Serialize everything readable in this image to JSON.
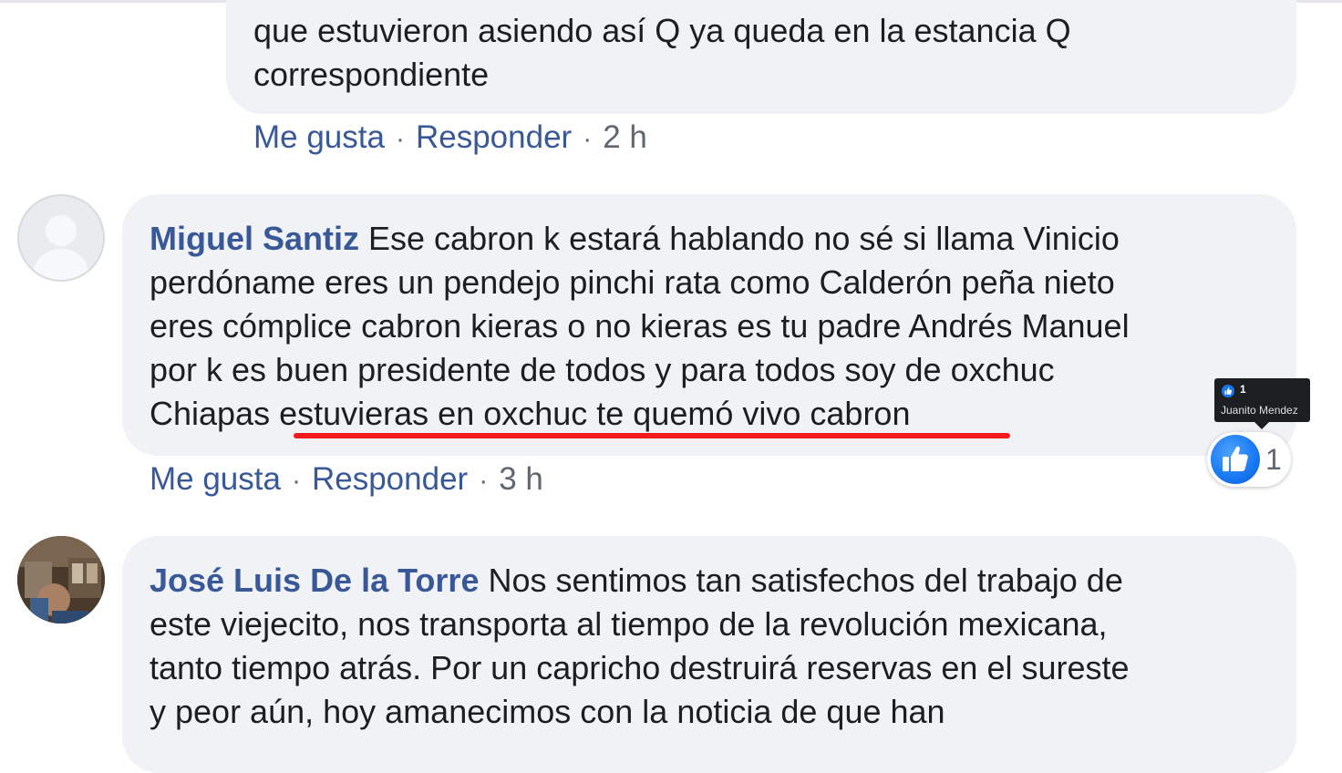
{
  "comments": [
    {
      "author": "",
      "text_lines": [
        "que estuvieron asiendo así Q ya queda en la estancia Q",
        "correspondiente"
      ],
      "like_label": "Me gusta",
      "reply_label": "Responder",
      "time": "2 h",
      "separator": "·"
    },
    {
      "author": "Miguel Santiz",
      "text_first": " Ese cabron k estará hablando no sé si llama Vinicio",
      "text_lines": [
        "perdóname eres un pendejo pinchi rata como Calderón peña nieto",
        "eres cómplice cabron kieras o no kieras es tu padre Andrés Manuel",
        "por k es buen presidente de todos y para todos soy de oxchuc"
      ],
      "text_last_prefix": "Chiapas ",
      "text_last_highlight": "estuvieras en oxchuc te quemó vivo cabron",
      "highlight_color": "#f4191c",
      "like_label": "Me gusta",
      "reply_label": "Responder",
      "time": "3 h",
      "separator": "·",
      "reaction": {
        "icon": "like-icon",
        "count": "1",
        "tooltip_count": "1",
        "tooltip_name": "Juanito Mendez"
      }
    },
    {
      "author": "José Luis De la Torre",
      "text_first": " Nos sentimos tan satisfechos del trabajo de",
      "text_lines": [
        "este viejecito, nos transporta al tiempo de la revolución mexicana,",
        "tanto tiempo atrás. Por un capricho destruirá reservas en el sureste",
        "y peor aún, hoy amanecimos con la noticia de que han"
      ]
    }
  ],
  "colors": {
    "author": "#385898",
    "bubble": "#f0f2f5",
    "meta": "#606770",
    "like_blue": "#1877f2"
  }
}
